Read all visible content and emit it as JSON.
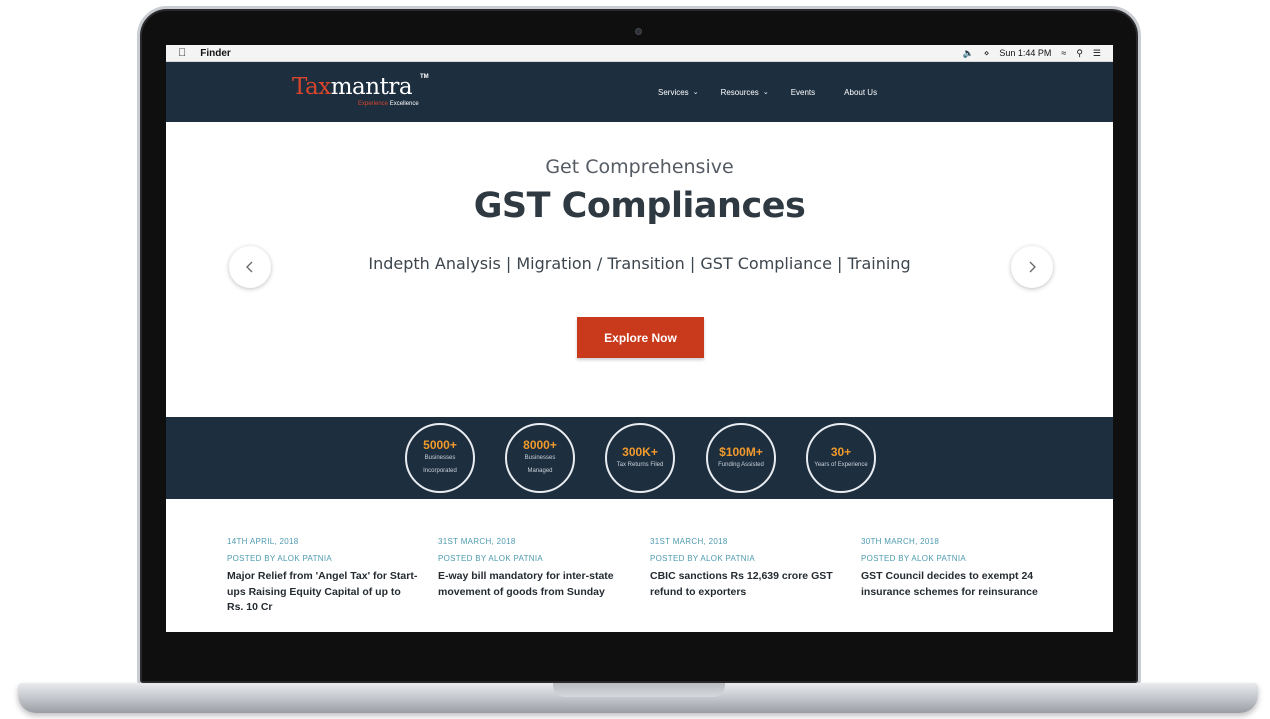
{
  "menubar": {
    "app_name": "Finder",
    "clock": "Sun 1:44 PM"
  },
  "site": {
    "logo": {
      "part1": "Tax",
      "part2": "mantra",
      "tm": "TM",
      "tagline1": "Experience",
      "tagline2": "Excellence"
    },
    "nav": [
      {
        "label": "Services",
        "has_dropdown": true
      },
      {
        "label": "Resources",
        "has_dropdown": true
      },
      {
        "label": "Events",
        "has_dropdown": false
      },
      {
        "label": "About Us",
        "has_dropdown": false
      }
    ]
  },
  "hero": {
    "subtitle": "Get Comprehensive",
    "title": "GST Compliances",
    "services": "Indepth Analysis | Migration / Transition | GST Compliance | Training",
    "cta": "Explore Now",
    "prev_icon": "chevron-left-icon",
    "next_icon": "chevron-right-icon"
  },
  "stats": [
    {
      "value": "5000+",
      "label": "Businesses Incorporated"
    },
    {
      "value": "8000+",
      "label": "Businesses Managed"
    },
    {
      "value": "300K+",
      "label": "Tax Returns Filed"
    },
    {
      "value": "$100M+",
      "label": "Funding Assisted"
    },
    {
      "value": "30+",
      "label": "Years of Experience"
    }
  ],
  "news": [
    {
      "date": "14TH APRIL, 2018",
      "author": "POSTED BY ALOK PATNIA",
      "title": "Major Relief from 'Angel Tax' for Start-ups Raising Equity Capital of up to Rs. 10 Cr"
    },
    {
      "date": "31ST MARCH, 2018",
      "author": "POSTED BY ALOK PATNIA",
      "title": "E-way bill mandatory for inter-state movement of goods from Sunday"
    },
    {
      "date": "31ST MARCH, 2018",
      "author": "POSTED BY ALOK PATNIA",
      "title": "CBIC sanctions Rs 12,639 crore GST refund to exporters"
    },
    {
      "date": "30TH MARCH, 2018",
      "author": "POSTED BY ALOK PATNIA",
      "title": "GST Council decides to exempt 24 insurance schemes for reinsurance"
    }
  ],
  "colors": {
    "navy": "#1d2e3f",
    "accent_orange": "#c9391b",
    "stat_orange": "#f19a2b",
    "teal": "#4e9bb0"
  }
}
